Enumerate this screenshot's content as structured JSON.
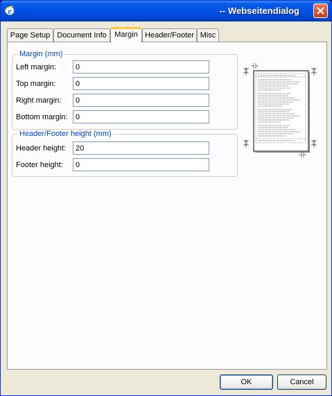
{
  "window": {
    "title": "-- Webseitendialog",
    "icon": "internet-explorer-icon",
    "close_icon": "close-icon",
    "accent": "#0054e3"
  },
  "tabs": [
    {
      "label": "Page Setup",
      "active": false
    },
    {
      "label": "Document Info",
      "active": false
    },
    {
      "label": "Margin",
      "active": true
    },
    {
      "label": "Header/Footer",
      "active": false
    },
    {
      "label": "Misc",
      "active": false
    }
  ],
  "margin_group": {
    "legend": "Margin (mm)",
    "left": {
      "label": "Left margin:",
      "value": "0"
    },
    "top": {
      "label": "Top margin:",
      "value": "0"
    },
    "right": {
      "label": "Right margin:",
      "value": "0"
    },
    "bottom": {
      "label": "Bottom margin:",
      "value": "0"
    }
  },
  "hf_group": {
    "legend": "Header/Footer height (mm)",
    "header": {
      "label": "Header height:",
      "value": "20"
    },
    "footer": {
      "label": "Footer height:",
      "value": "0"
    }
  },
  "buttons": {
    "ok": "OK",
    "cancel": "Cancel"
  }
}
